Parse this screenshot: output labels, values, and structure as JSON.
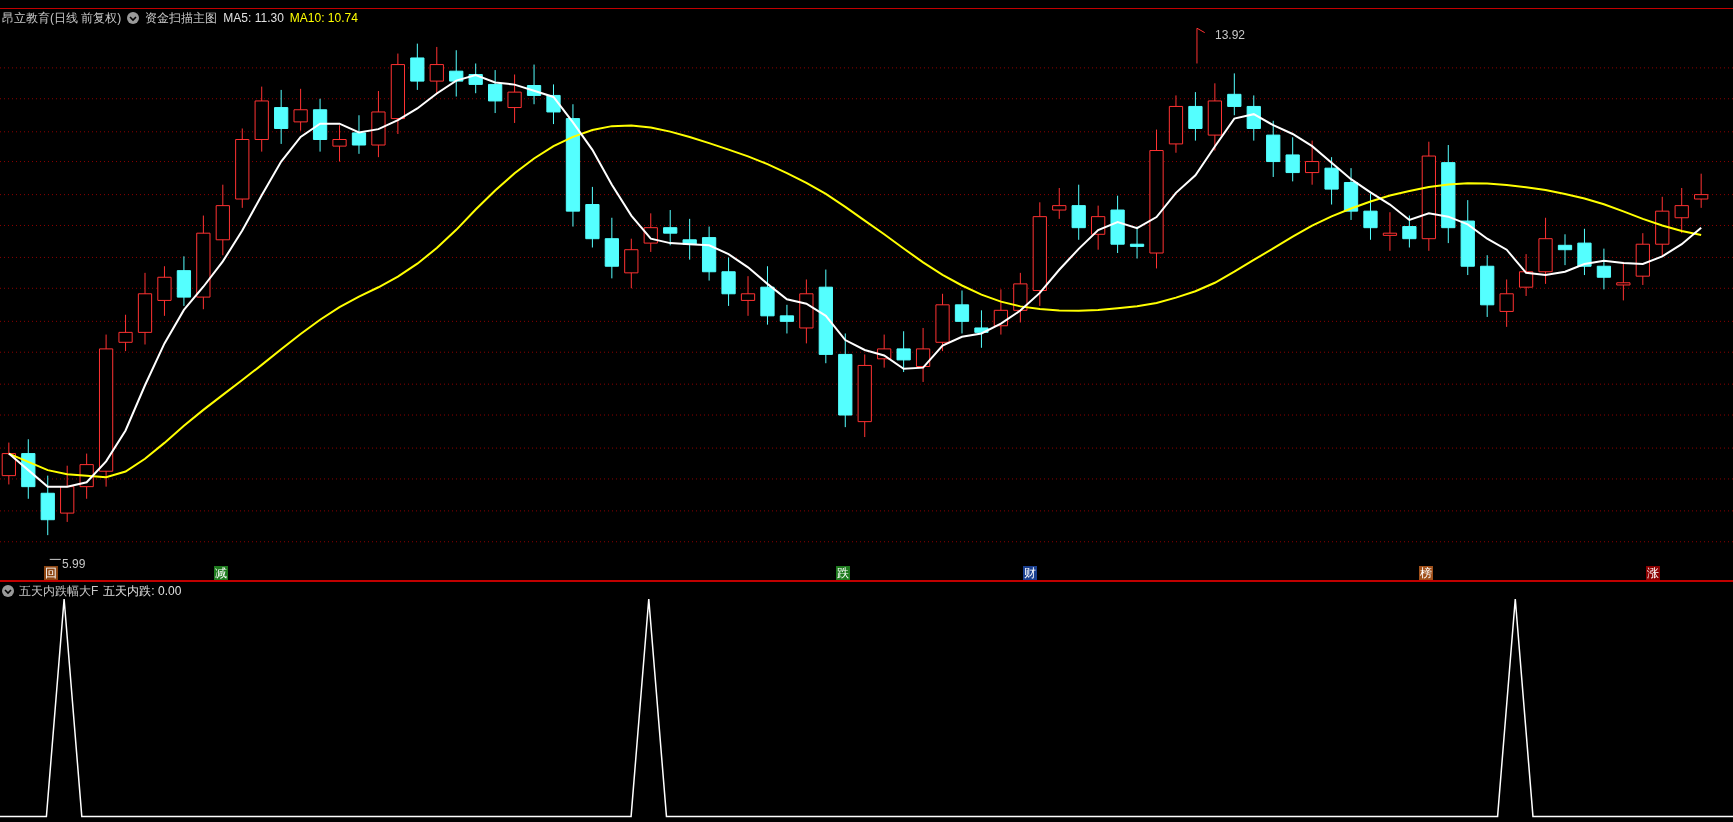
{
  "header": {
    "stock": "昂立教育(日线 前复权)",
    "indicator": "资金扫描主图",
    "ma5": "MA5: 11.30",
    "ma10": "MA10: 10.74"
  },
  "main_chart": {
    "high_label": "13.92",
    "low_label": "5.99"
  },
  "signals": [
    {
      "label": "回",
      "color": "#8b4513"
    },
    {
      "label": "减",
      "color": "#1e7a1e"
    },
    {
      "label": "跌",
      "color": "#1e7a1e"
    },
    {
      "label": "财",
      "color": "#1a3f8f"
    },
    {
      "label": "榜",
      "color": "#a0501a"
    },
    {
      "label": "涨",
      "color": "#8b0000"
    }
  ],
  "lower_panel": {
    "indicator": "五天内跌幅大F",
    "reading": "五天内跌: 0.00"
  }
}
